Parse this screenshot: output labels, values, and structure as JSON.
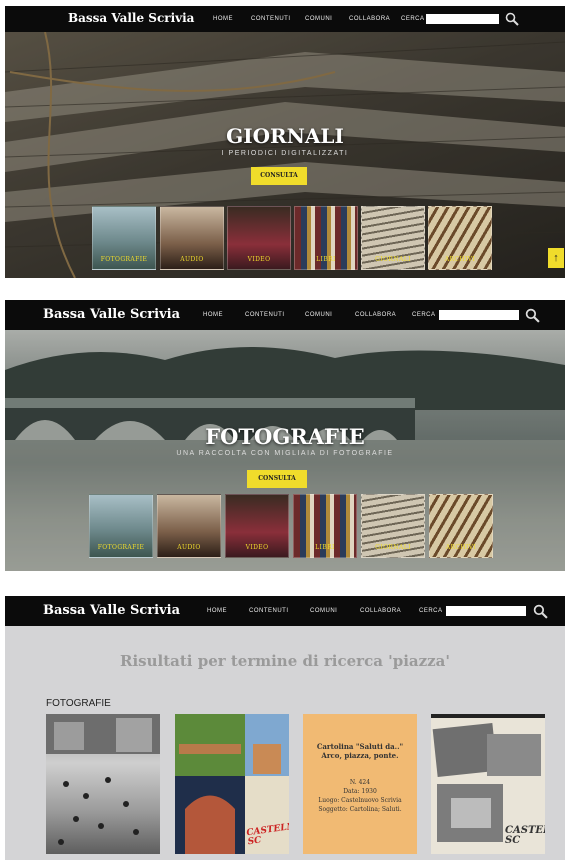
{
  "nav": {
    "brand": "Bassa Valle Scrivia",
    "menu": [
      "HOME",
      "CONTENUTI",
      "COMUNI",
      "COLLABORA",
      "CERCA"
    ],
    "search_value": ""
  },
  "panels": [
    {
      "title": "GIORNALI",
      "subtitle": "I PERIODICI DIGITALIZZATI",
      "button": "CONSULTA"
    },
    {
      "title": "FOTOGRAFIE",
      "subtitle": "UNA RACCOLTA CON MIGLIAIA DI FOTOGRAFIE",
      "button": "CONSULTA"
    }
  ],
  "categories": [
    "FOTOGRAFIE",
    "AUDIO",
    "VIDEO",
    "LIBRI",
    "GIORNALI",
    "ARCHIVI"
  ],
  "back_to_top": "↑",
  "results": {
    "heading": "Risultati per termine di ricerca 'piazza'",
    "section": "FOTOGRAFIE",
    "card3": {
      "caption": "Cartolina \"Saluti da..\" Arco, piazza, ponte.",
      "number": "N. 424",
      "date": "Data: 1930",
      "place": "Luogo: Castelnuovo Scrivia",
      "subject": "Soggetto: Cartolina; Saluti."
    },
    "card2_text": "CASTELN SC",
    "card4_text": "CASTEL SC"
  },
  "colors": {
    "accent": "#f0dc2b",
    "nav_bg": "#0b0b0b",
    "results_bg": "#d4d4d6"
  }
}
